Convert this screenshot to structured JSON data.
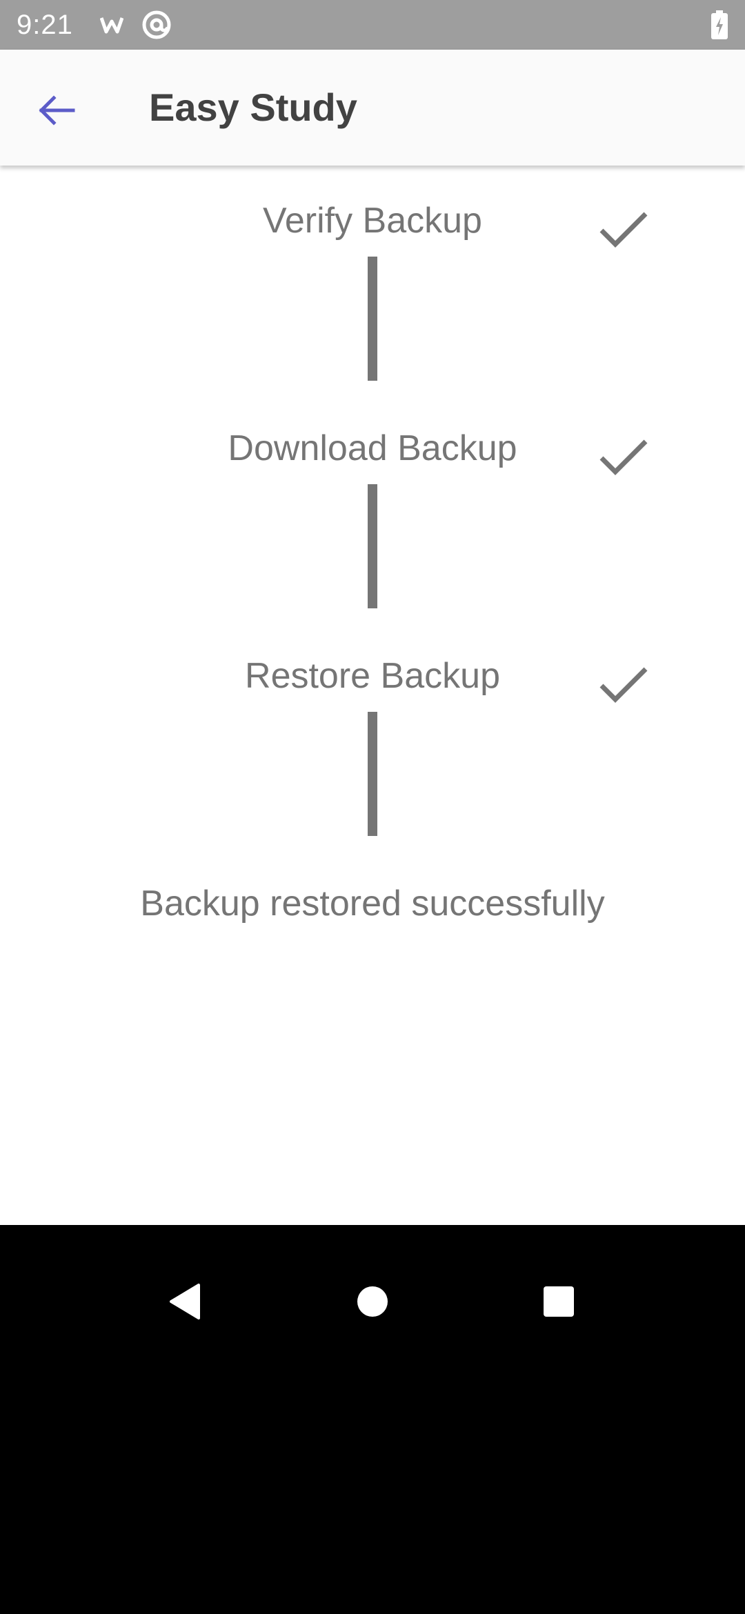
{
  "status_bar": {
    "time": "9:21",
    "icons": [
      "w-notification-icon",
      "at-sign-icon",
      "battery-charging-icon"
    ],
    "color": "#9e9e9e"
  },
  "app_bar": {
    "title": "Easy Study",
    "back_icon": "arrow-left-icon",
    "accent": "#5c5cc8"
  },
  "steps": [
    {
      "label": "Verify Backup",
      "status_icon": "check-icon",
      "done": true
    },
    {
      "label": "Download Backup",
      "status_icon": "check-icon",
      "done": true
    },
    {
      "label": "Restore Backup",
      "status_icon": "check-icon",
      "done": true
    }
  ],
  "result": {
    "message": "Backup restored successfully"
  },
  "nav_bar": {
    "buttons": [
      "back-triangle-icon",
      "home-circle-icon",
      "recents-square-icon"
    ]
  }
}
